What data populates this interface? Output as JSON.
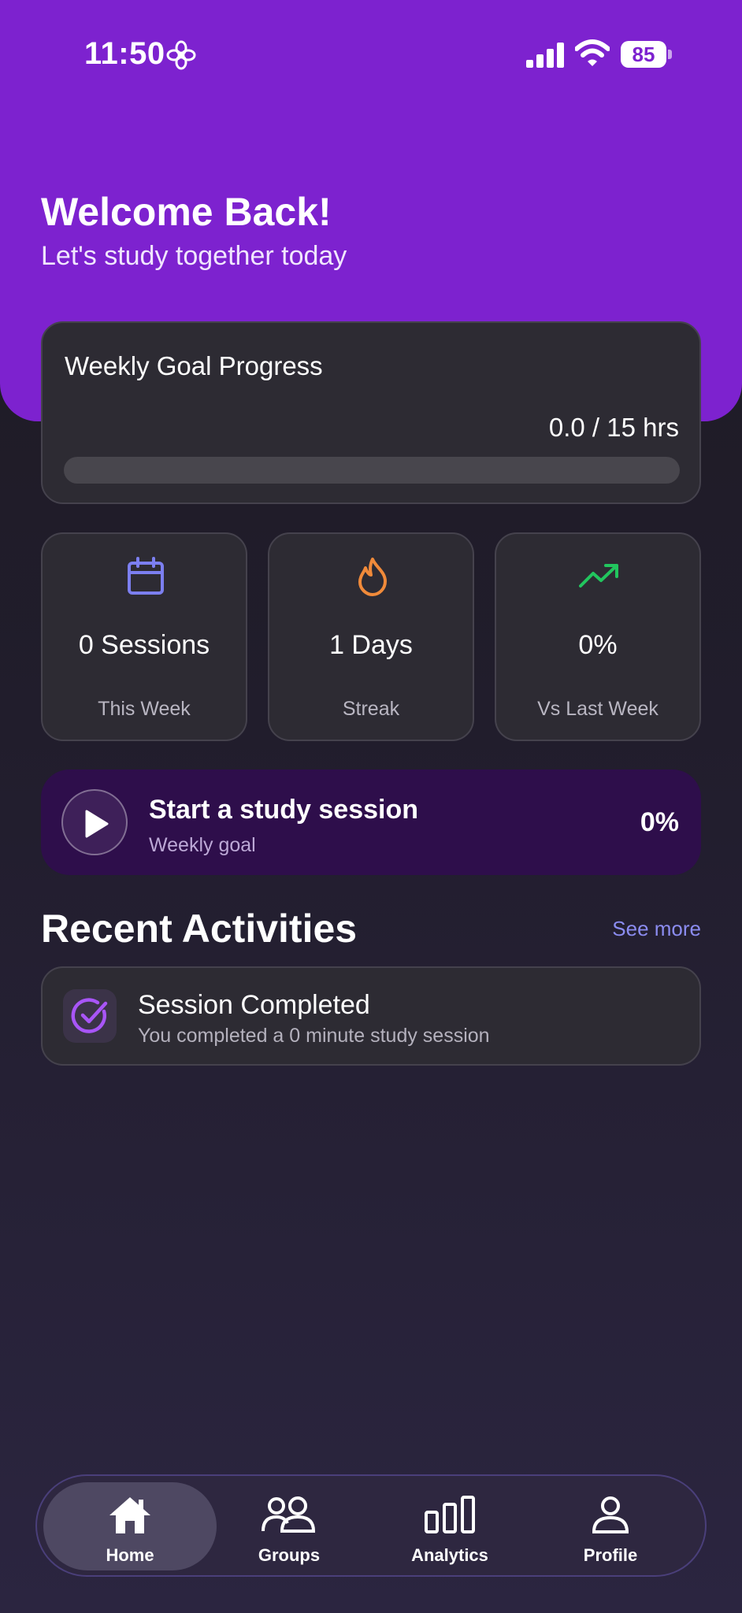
{
  "status_bar": {
    "time": "11:50",
    "battery": "85"
  },
  "header": {
    "title": "Welcome Back!",
    "subtitle": "Let's study together today"
  },
  "weekly_goal": {
    "title": "Weekly Goal Progress",
    "value_text": "0.0 / 15 hrs",
    "progress_fraction": 0.0,
    "accent_color": "#8b5cf6"
  },
  "stats": [
    {
      "value": "0 Sessions",
      "label": "This Week",
      "icon": "calendar-icon",
      "color": "#7c7ff0"
    },
    {
      "value": "1 Days",
      "label": "Streak",
      "icon": "flame-icon",
      "color": "#f08a3a"
    },
    {
      "value": "0%",
      "label": "Vs Last Week",
      "icon": "trending-up-icon",
      "color": "#22c55e"
    }
  ],
  "session_banner": {
    "title": "Start a study session",
    "subtitle": "Weekly goal",
    "percent": "0%"
  },
  "recent": {
    "title": "Recent Activities",
    "see_more": "See more",
    "items": [
      {
        "title": "Session Completed",
        "description": "You completed a 0 minute study session",
        "icon": "check-circle-icon"
      }
    ]
  },
  "nav": {
    "items": [
      {
        "label": "Home",
        "icon": "home-icon",
        "active": true
      },
      {
        "label": "Groups",
        "icon": "users-icon",
        "active": false
      },
      {
        "label": "Analytics",
        "icon": "bar-chart-icon",
        "active": false
      },
      {
        "label": "Profile",
        "icon": "user-icon",
        "active": false
      }
    ]
  },
  "colors": {
    "header_purple": "#7d22cf",
    "card": "#2d2b33",
    "banner": "#2e0e4b",
    "link": "#8b8cf0"
  }
}
